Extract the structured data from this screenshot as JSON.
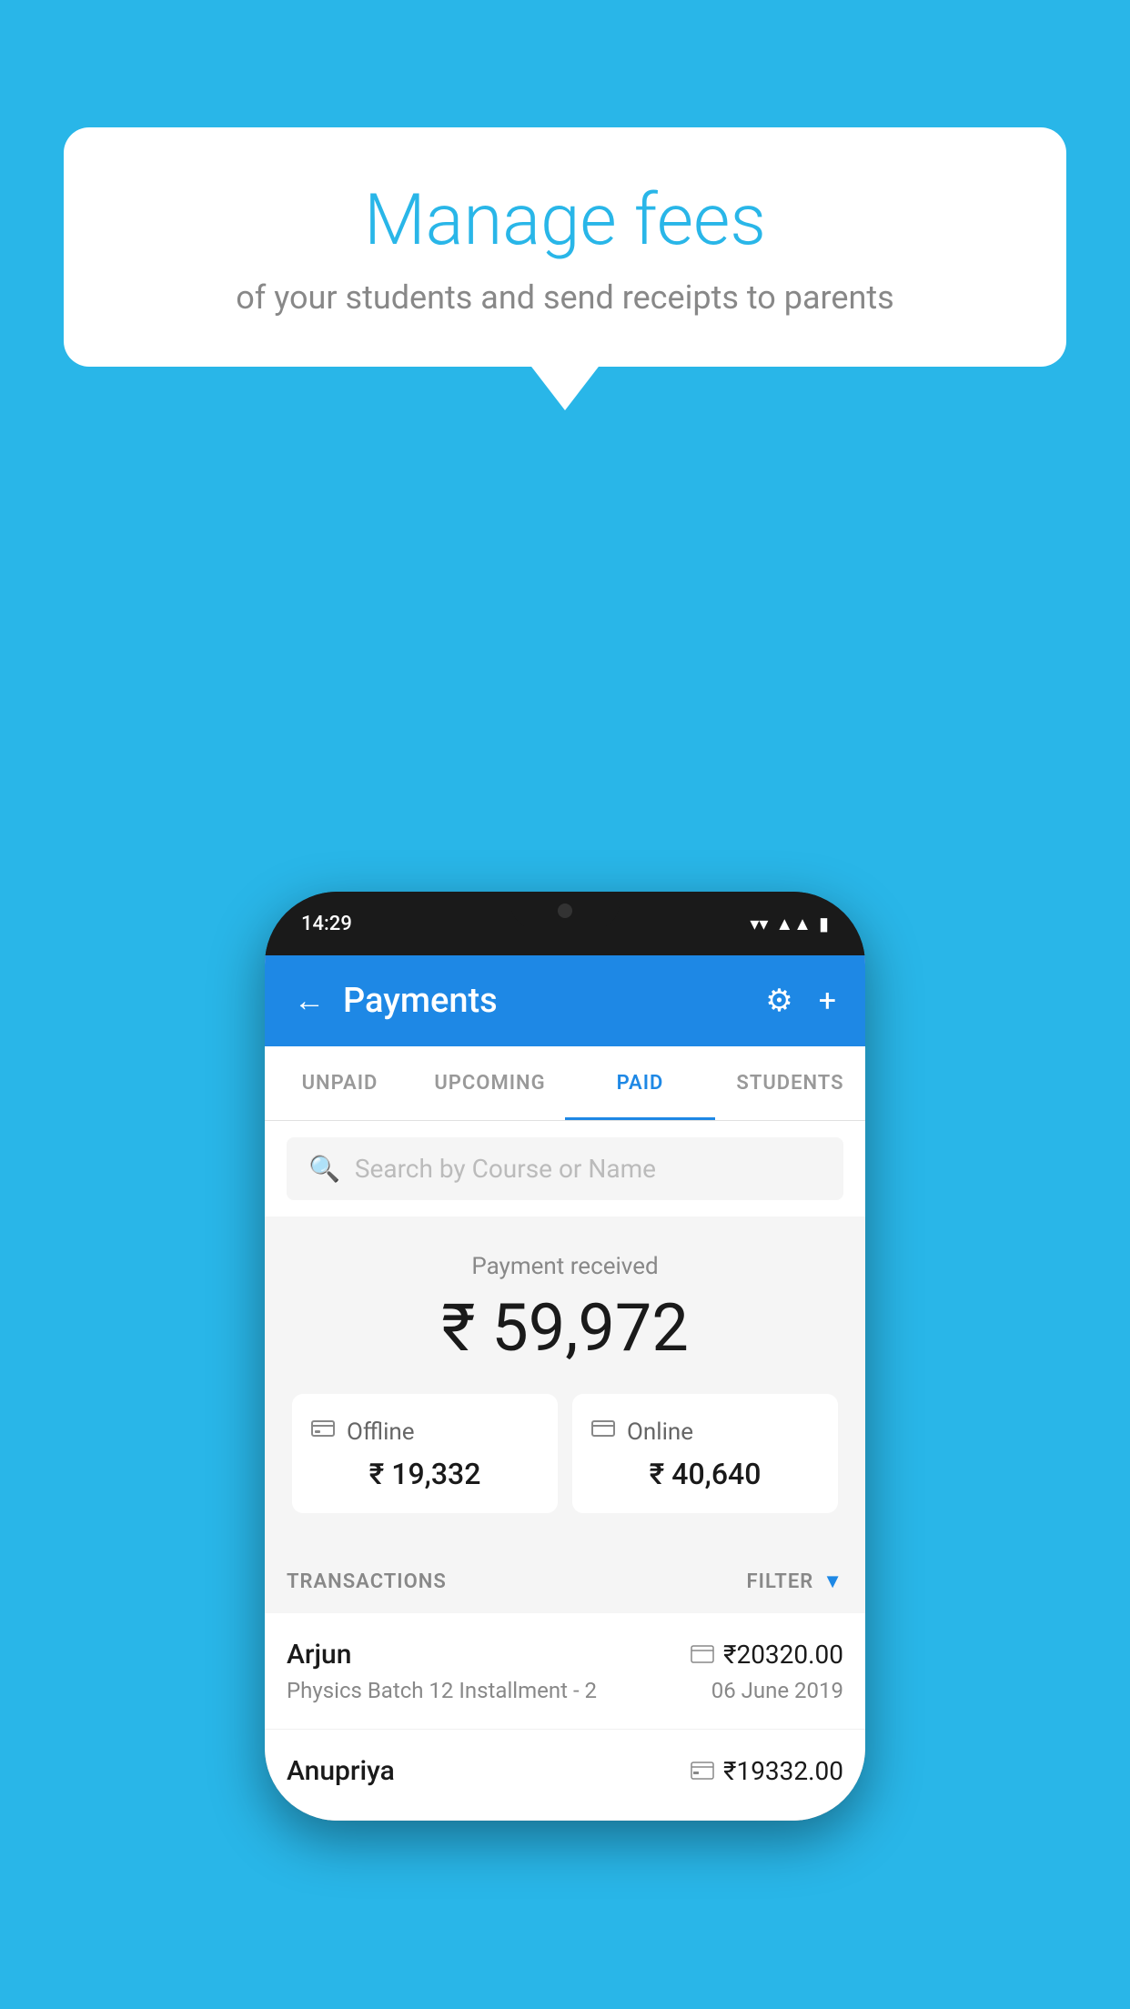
{
  "background_color": "#29b6e8",
  "speech_bubble": {
    "title": "Manage fees",
    "subtitle": "of your students and send receipts to parents"
  },
  "phone": {
    "time": "14:29",
    "header": {
      "title": "Payments",
      "back_label": "←",
      "gear_label": "⚙",
      "plus_label": "+"
    },
    "tabs": [
      {
        "label": "UNPAID",
        "active": false
      },
      {
        "label": "UPCOMING",
        "active": false
      },
      {
        "label": "PAID",
        "active": true
      },
      {
        "label": "STUDENTS",
        "active": false
      }
    ],
    "search": {
      "placeholder": "Search by Course or Name"
    },
    "payment_section": {
      "label": "Payment received",
      "amount": "₹ 59,972",
      "offline": {
        "icon": "💳",
        "label": "Offline",
        "amount": "₹ 19,332"
      },
      "online": {
        "icon": "💳",
        "label": "Online",
        "amount": "₹ 40,640"
      }
    },
    "transactions": {
      "label": "TRANSACTIONS",
      "filter_label": "FILTER",
      "items": [
        {
          "name": "Arjun",
          "amount": "₹20320.00",
          "description": "Physics Batch 12 Installment - 2",
          "date": "06 June 2019",
          "type": "online"
        },
        {
          "name": "Anupriya",
          "amount": "₹19332.00",
          "description": "",
          "date": "",
          "type": "offline"
        }
      ]
    }
  }
}
